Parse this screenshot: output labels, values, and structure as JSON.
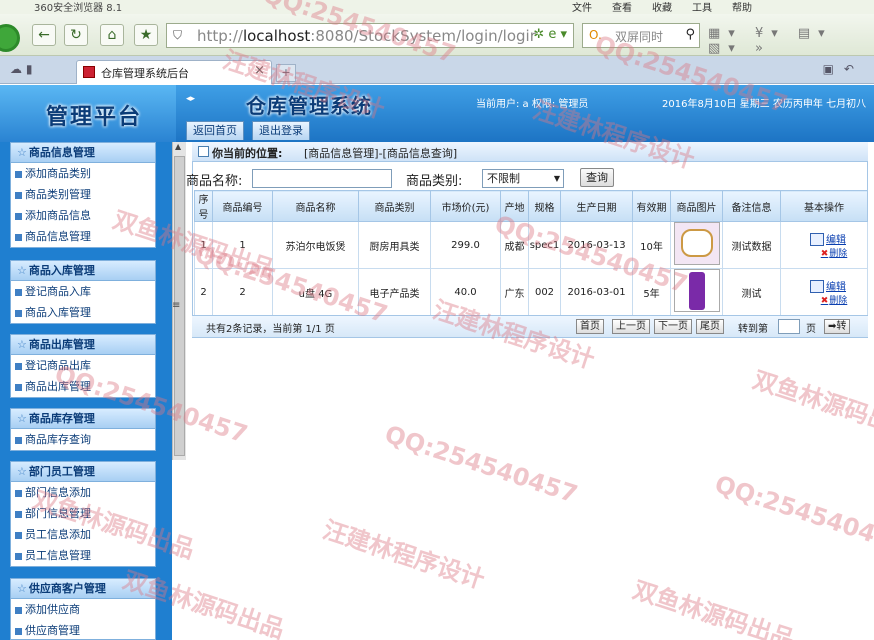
{
  "browser": {
    "title": "360安全浏览器 8.1",
    "menus": [
      "文件",
      "查看",
      "收藏",
      "工具",
      "帮助"
    ],
    "url_prefix": "http://",
    "url_host": "localhost",
    "url_rest": ":8080/StockSystem/login/logir",
    "search_placeholder": "双屏同时",
    "tab_title": "仓库管理系统后台"
  },
  "header": {
    "platform_title": "管理平台",
    "system_title": "仓库管理系统",
    "user_info": "当前用户: a 权限: 管理员",
    "date_info": "2016年8月10日 星期三 农历丙申年 七月初八",
    "home_button": "返回首页",
    "logout_button": "退出登录"
  },
  "sidebar": {
    "groups": [
      {
        "title": "商品信息管理",
        "items": [
          "添加商品类别",
          "商品类别管理",
          "添加商品信息",
          "商品信息管理"
        ]
      },
      {
        "title": "商品入库管理",
        "items": [
          "登记商品入库",
          "商品入库管理"
        ]
      },
      {
        "title": "商品出库管理",
        "items": [
          "登记商品出库",
          "商品出库管理"
        ]
      },
      {
        "title": "商品库存管理",
        "items": [
          "商品库存查询"
        ]
      },
      {
        "title": "部门员工管理",
        "items": [
          "部门信息添加",
          "部门信息管理",
          "员工信息添加",
          "员工信息管理"
        ]
      },
      {
        "title": "供应商客户管理",
        "items": [
          "添加供应商",
          "供应商管理"
        ]
      }
    ]
  },
  "content": {
    "location_label": "你当前的位置:",
    "location_value": "[商品信息管理]-[商品信息查询]",
    "filter": {
      "name_label": "商品名称:",
      "name_value": "",
      "category_label": "商品类别:",
      "category_selected": "不限制",
      "query_button": "查询"
    },
    "table": {
      "columns": [
        "序号",
        "商品编号",
        "商品名称",
        "商品类别",
        "市场价(元)",
        "产地",
        "规格",
        "生产日期",
        "有效期",
        "商品图片",
        "备注信息",
        "基本操作"
      ],
      "rows": [
        {
          "seq": "1",
          "code": "1",
          "name": "苏泊尔电饭煲",
          "category": "厨房用具类",
          "price": "299.0",
          "origin": "成都",
          "spec": "spec1",
          "date": "2016-03-13",
          "validity": "10年",
          "image": "rice-cooker-image",
          "remark": "测试数据",
          "edit": "编辑",
          "delete": "删除"
        },
        {
          "seq": "2",
          "code": "2",
          "name": "u盘 4G",
          "category": "电子产品类",
          "price": "40.0",
          "origin": "广东",
          "spec": "002",
          "date": "2016-03-01",
          "validity": "5年",
          "image": "usb-drive-image",
          "remark": "测试",
          "edit": "编辑",
          "delete": "删除"
        }
      ]
    },
    "pager": {
      "info": "共有2条记录，当前第 1/1 页",
      "first": "首页",
      "prev": "上一页",
      "next": "下一页",
      "last": "尾页",
      "jump_label": "转到第",
      "page_unit": "页",
      "go": "➡转"
    }
  },
  "watermarks": [
    "QQ:254540457",
    "汪建林程序设计",
    "双鱼林源码出品"
  ]
}
